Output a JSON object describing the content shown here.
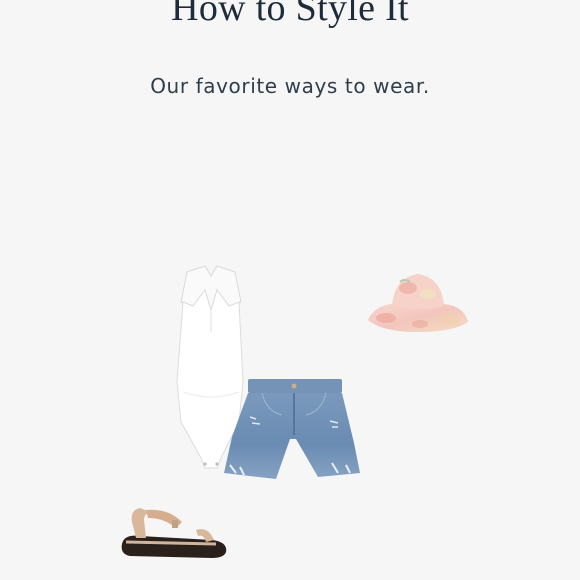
{
  "header": {
    "title": "How to Style It",
    "subtitle": "Our favorite ways to wear."
  },
  "outfit": {
    "items": [
      {
        "name": "white collared sleeveless bodysuit",
        "icon": "bodysuit-icon"
      },
      {
        "name": "floral bucket hat",
        "icon": "bucket-hat-icon"
      },
      {
        "name": "distressed denim shorts",
        "icon": "denim-shorts-icon"
      },
      {
        "name": "ankle strap platform sandal",
        "icon": "sandal-icon"
      }
    ]
  },
  "colors": {
    "background": "#f6f6f6",
    "title": "#1d2b3a",
    "denim": "#6f8fb3",
    "hat_pink": "#f2c4c0",
    "hat_peach": "#f4dcc2",
    "sandal_tan": "#d9b79a",
    "sandal_sole": "#2a211d"
  }
}
